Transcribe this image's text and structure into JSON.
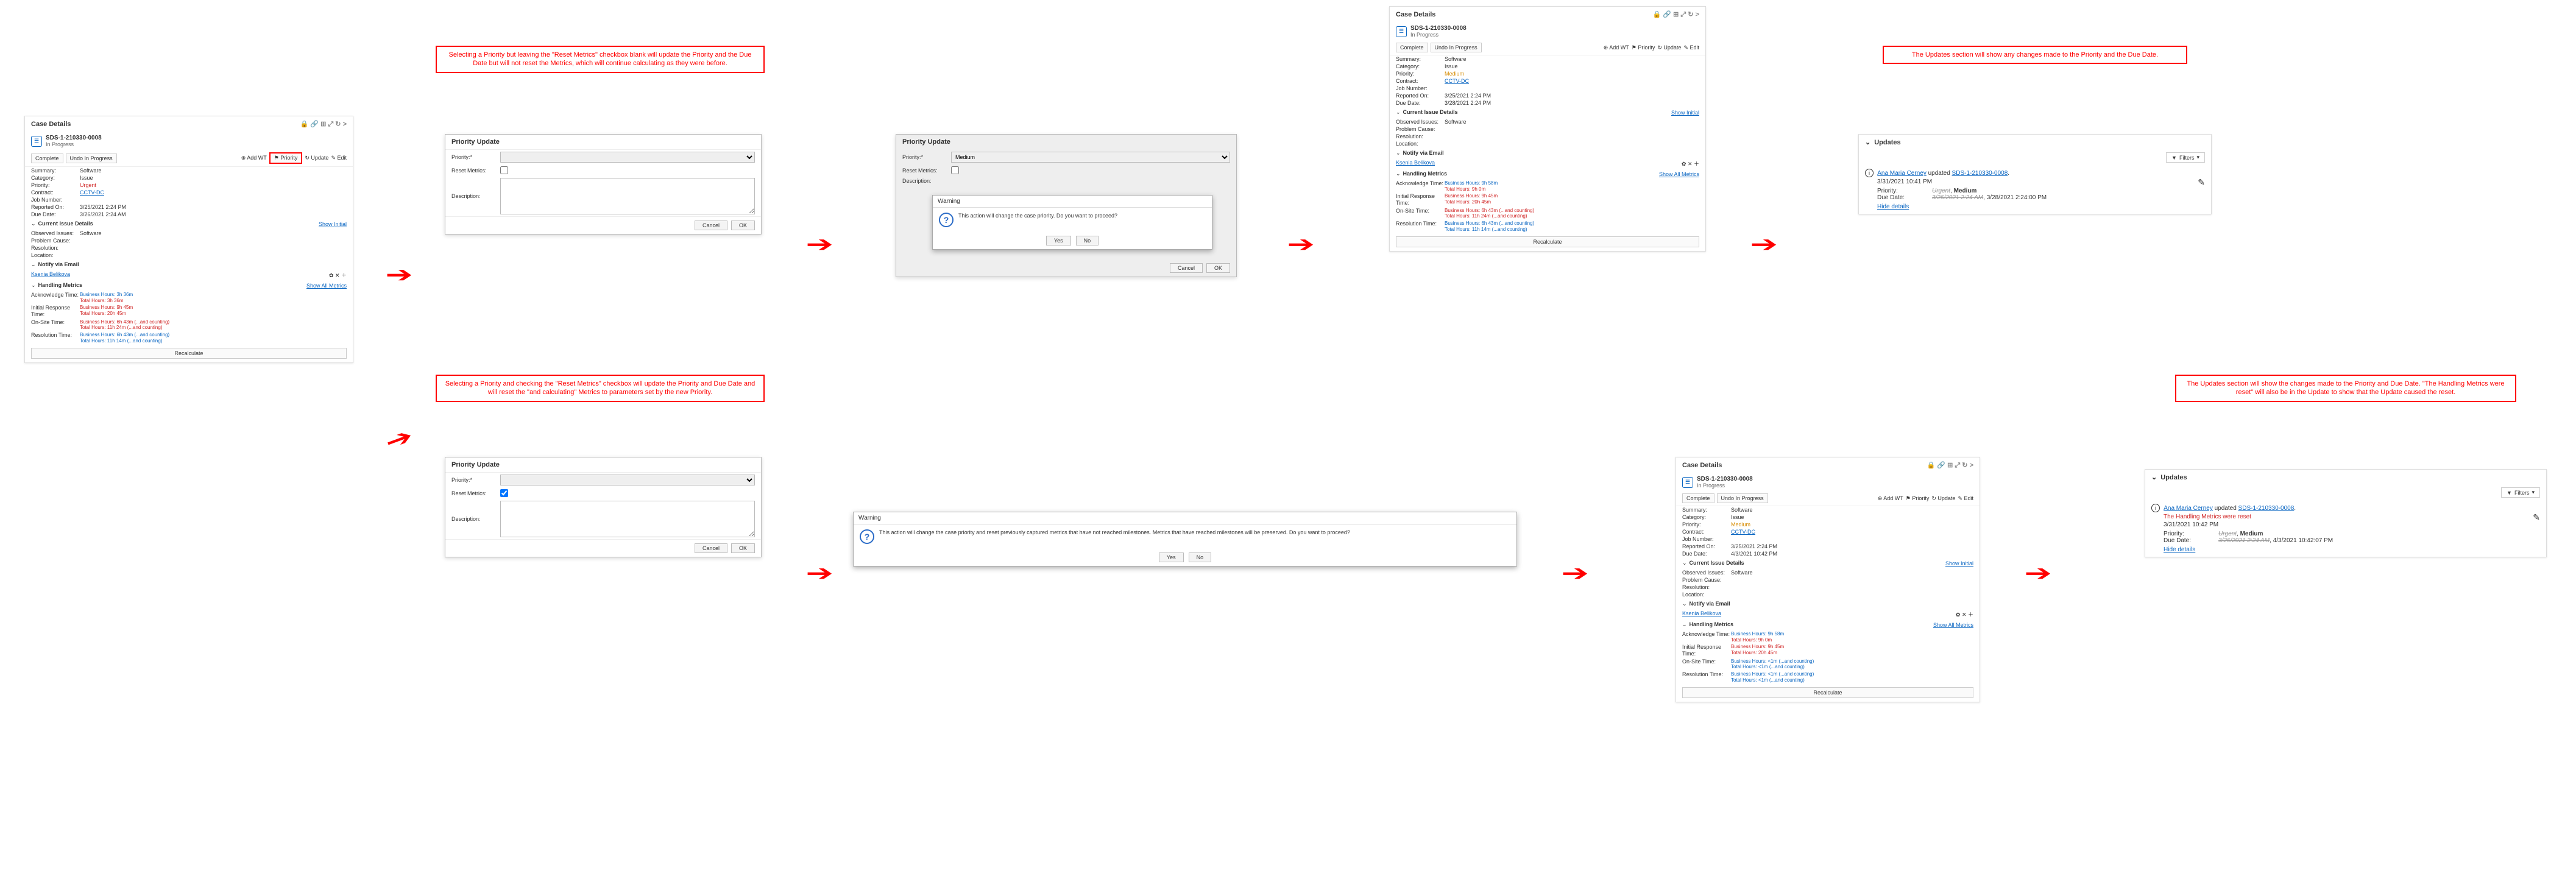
{
  "case": {
    "panel_title": "Case Details",
    "id": "SDS-1-210330-0008",
    "status": "In Progress",
    "complete": "Complete",
    "undo": "Undo In Progress",
    "add_wt": "Add WT",
    "priority_btn": "Priority",
    "update_btn": "Update",
    "edit_btn": "Edit",
    "summary_k": "Summary:",
    "summary_v": "Software",
    "category_k": "Category:",
    "category_v": "Issue",
    "priority_k": "Priority:",
    "priority_v": "Urgent",
    "priority_v_med": "Medium",
    "contract_k": "Contract:",
    "contract_v": "CCTV-DC",
    "jobnum_k": "Job Number:",
    "reported_k": "Reported On:",
    "reported_v": "3/25/2021 2:24 PM",
    "due_k": "Due Date:",
    "due_v1": "3/26/2021 2:24 AM",
    "due_v2": "3/28/2021 2:24 PM",
    "due_v3": "4/3/2021 10:42 PM",
    "cid_title": "Current Issue Details",
    "show_initial": "Show Initial",
    "obs_k": "Observed Issues:",
    "obs_v": "Software",
    "cause_k": "Problem Cause:",
    "res_k": "Resolution:",
    "loc_k": "Location:",
    "notify_title": "Notify via Email",
    "contact1": "Ksenia Belikova",
    "metrics_title": "Handling Metrics",
    "show_all": "Show All Metrics",
    "ack_k": "Acknowledge Time:",
    "irt_k": "Initial Response Time:",
    "ost_k": "On-Site Time:",
    "rest_k": "Resolution Time:",
    "ack_l1": "Business Hours: 3h 36m",
    "ack_l2": "Total Hours: 3h 36m",
    "irt_l1": "Business Hours: 9h 45m",
    "irt_l2": "Total Hours: 20h 45m",
    "ost_l1": "Business Hours: 6h 43m (...and counting)",
    "ost_l2": "Total Hours: 11h 24m (...and counting)",
    "rest_l1": "Business Hours: 6h 43m (...and counting)",
    "rest_l2": "Total Hours: 11h 14m (...and counting)",
    "ack2_l1": "Business Hours: 9h 58m",
    "ack2_l2": "Total Hours: 9h 0m",
    "ost3_l1": "Business Hours: <1m (...and counting)",
    "ost3_l2": "Total Hours: <1m (...and counting)",
    "rest3_l1": "Business Hours: <1m (...and counting)",
    "rest3_l2": "Total Hours: <1m (...and counting)",
    "recalc": "Recalculate"
  },
  "dlg": {
    "title": "Priority Update",
    "priority": "Priority:*",
    "reset": "Reset Metrics:",
    "desc": "Description:",
    "cancel": "Cancel",
    "ok": "OK",
    "sel_med": "Medium"
  },
  "warn": {
    "title": "Warning",
    "msg1": "This action will change the case priority. Do you want to proceed?",
    "msg2": "This action will change the case priority and reset previously captured metrics that have not reached milestones. Metrics that have reached milestones will be preserved. Do you want to proceed?",
    "yes": "Yes",
    "no": "No"
  },
  "callout": {
    "c1": "Selecting a Priority but leaving the \"Reset Metrics\" checkbox blank will update the Priority and the Due Date but will not reset the Metrics, which will continue calculating as they were before.",
    "c2": "Selecting a Priority and checking the \"Reset Metrics\" checkbox will update the Priority and Due Date and will reset the \"and calculating\" Metrics to parameters set by the new Priority.",
    "c3": "The Updates section will show any changes made to the Priority and the Due Date.",
    "c4": "The Updates section will show the changes made to the Priority and Due Date. \"The Handling Metrics were reset\" will also be in the Update to show that the Update caused the reset."
  },
  "upd": {
    "title": "Updates",
    "filters": "Filters",
    "author": "Ana Maria Cerney",
    "action": " updated ",
    "link": "SDS-1-210330-0008",
    "ts1": "3/31/2021 10:41 PM",
    "pk": "Priority:",
    "pv_old": "Urgent",
    "pv_new": "Medium",
    "dk": "Due Date:",
    "dv_old": "3/26/2021 2:24 AM",
    "dv_new1": "3/28/2021 2:24:00 PM",
    "hide": "Hide details",
    "reset_msg": "The Handling Metrics were reset",
    "ts2": "3/31/2021 10:42 PM",
    "dv_new2": "4/3/2021 10:42:07 PM"
  }
}
